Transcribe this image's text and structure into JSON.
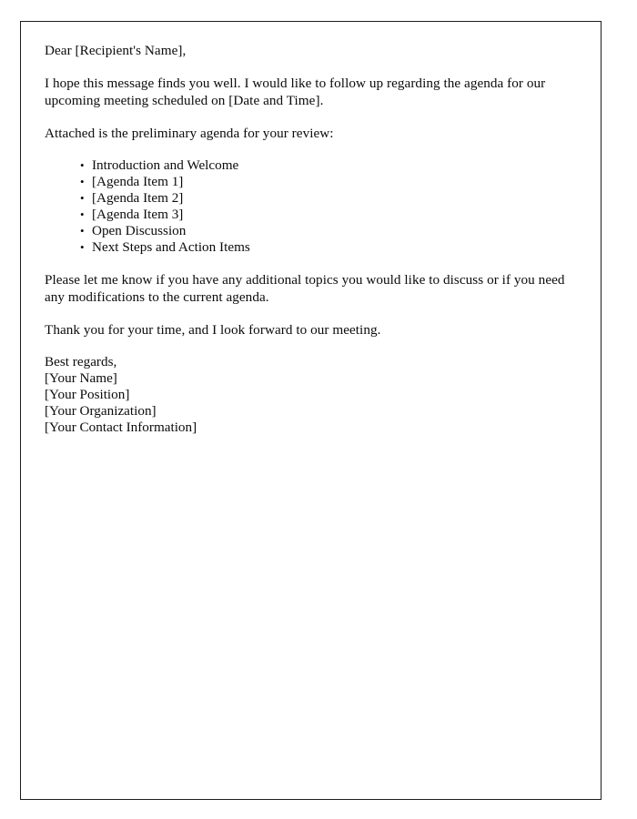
{
  "document": {
    "salutation": "Dear [Recipient's Name],",
    "intro_paragraph": "I hope this message finds you well. I would like to follow up regarding the agenda for our upcoming meeting scheduled on [Date and Time].",
    "attachment_paragraph": "Attached is the preliminary agenda for your review:",
    "agenda_items": [
      "Introduction and Welcome",
      "[Agenda Item 1]",
      "[Agenda Item 2]",
      "[Agenda Item 3]",
      "Open Discussion",
      "Next Steps and Action Items"
    ],
    "followup_paragraph": "Please let me know if you have any additional topics you would like to discuss or if you need any modifications to the current agenda.",
    "closing_paragraph": "Thank you for your time, and I look forward to our meeting.",
    "signature": {
      "closing": "Best regards,",
      "name": "[Your Name]",
      "position": "[Your Position]",
      "organization": "[Your Organization]",
      "contact": "[Your Contact Information]"
    }
  },
  "style": {
    "text_color": "#0b0b0b",
    "border_color": "#1c1c1c",
    "background_color": "#ffffff"
  }
}
